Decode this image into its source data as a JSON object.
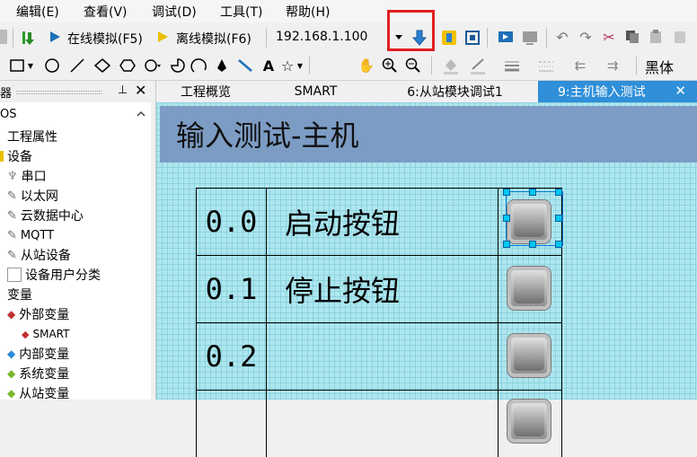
{
  "menubar": {
    "items": [
      "编辑(E)",
      "查看(V)",
      "调试(D)",
      "工具(T)",
      "帮助(H)"
    ]
  },
  "toolbar": {
    "online_sim": "在线模拟(F5)",
    "offline_sim": "离线模拟(F6)",
    "ip_address": "192.168.1.100",
    "font_name": "黑体"
  },
  "left_panel": {
    "top_item": "OS",
    "items": [
      {
        "label": "工程属性",
        "icon": "project-icon"
      },
      {
        "label": "设备",
        "icon": "device-folder-icon"
      },
      {
        "label": "串口",
        "icon": "serial-port-icon"
      },
      {
        "label": "以太网",
        "icon": "ethernet-icon"
      },
      {
        "label": "云数据中心",
        "icon": "cloud-icon"
      },
      {
        "label": "MQTT",
        "icon": "mqtt-icon"
      },
      {
        "label": "从站设备",
        "icon": "slave-icon"
      },
      {
        "label": "设备用户分类",
        "icon": "user-category-icon"
      },
      {
        "label": "变量",
        "icon": "variable-folder-icon"
      },
      {
        "label": "外部变量",
        "icon": "external-variable-icon"
      },
      {
        "label": "SMART",
        "icon": "smart-icon"
      },
      {
        "label": "内部变量",
        "icon": "internal-variable-icon"
      },
      {
        "label": "系统变量",
        "icon": "system-variable-icon"
      },
      {
        "label": "从站变量",
        "icon": "slave-variable-icon"
      }
    ]
  },
  "tabs": [
    {
      "label": "工程概览"
    },
    {
      "label": "SMART"
    },
    {
      "label": "6:从站模块调试1"
    },
    {
      "label": "9:主机输入测试",
      "active": true
    }
  ],
  "canvas": {
    "title": "输入测试-主机",
    "rows": [
      {
        "num": "0.0",
        "label": "启动按钮",
        "selected": true
      },
      {
        "num": "0.1",
        "label": "停止按钮",
        "selected": false
      },
      {
        "num": "0.2",
        "label": "",
        "selected": false
      },
      {
        "num": "",
        "label": "",
        "selected": false
      }
    ]
  },
  "colors": {
    "highlight_box": "#e02020",
    "active_tab": "#2f8fd8",
    "title_bar": "#7c9cc4",
    "canvas_bg": "#aee6ee"
  }
}
